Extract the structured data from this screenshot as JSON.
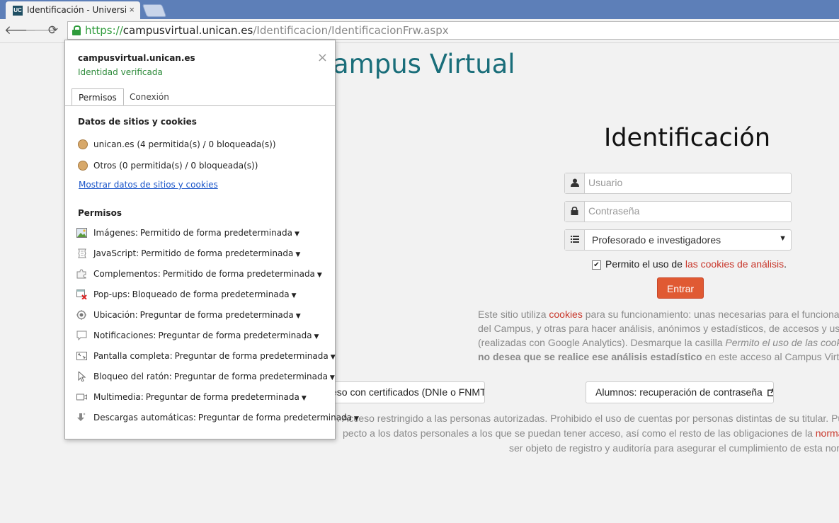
{
  "browser": {
    "tab_title": "Identificación - Universidad",
    "tab_close": "×",
    "favicon_text": "UC",
    "url_scheme": "https://",
    "url_host": "campusvirtual.unican.es",
    "url_path": "/Identificacion/IdentificacionFrw.aspx",
    "back": "🡐",
    "forward": "🡒",
    "reload": "⟳"
  },
  "popup": {
    "site": "campusvirtual.unican.es",
    "identity": "Identidad verificada",
    "close": "×",
    "tabs": [
      "Permisos",
      "Conexión"
    ],
    "cookies_heading": "Datos de sitios y cookies",
    "cookie_rows": [
      "unican.es (4 permitida(s) / 0 bloqueada(s))",
      "Otros (0 permitida(s) / 0 bloqueada(s))"
    ],
    "show_link": "Mostrar datos de sitios y cookies",
    "perms_heading": "Permisos",
    "permissions": [
      {
        "label": "Imágenes:",
        "value": "Permitido de forma predeterminada",
        "icon": "image-icon"
      },
      {
        "label": "JavaScript:",
        "value": "Permitido de forma predeterminada",
        "icon": "script-icon"
      },
      {
        "label": "Complementos:",
        "value": "Permitido de forma predeterminada",
        "icon": "puzzle-icon"
      },
      {
        "label": "Pop-ups:",
        "value": "Bloqueado de forma predeterminada",
        "icon": "popup-blocked-icon"
      },
      {
        "label": "Ubicación:",
        "value": "Preguntar de forma predeterminada",
        "icon": "location-icon"
      },
      {
        "label": "Notificaciones:",
        "value": "Preguntar de forma predeterminada",
        "icon": "speech-bubble-icon"
      },
      {
        "label": "Pantalla completa:",
        "value": "Preguntar de forma predeterminada",
        "icon": "fullscreen-icon"
      },
      {
        "label": "Bloqueo del ratón:",
        "value": "Preguntar de forma predeterminada",
        "icon": "cursor-icon"
      },
      {
        "label": "Multimedia:",
        "value": "Preguntar de forma predeterminada",
        "icon": "camera-icon"
      },
      {
        "label": "Descargas automáticas:",
        "value": "Preguntar de forma predeterminada",
        "icon": "download-icon"
      }
    ]
  },
  "page": {
    "brand": "ampus Virtual",
    "heading": "Identificación",
    "user_placeholder": "Usuario",
    "password_placeholder": "Contraseña",
    "role_selected": "Profesorado e investigadores",
    "consent_prefix": "Permito el uso de ",
    "consent_link": "las cookies de análisis",
    "consent_suffix": ".",
    "submit": "Entrar",
    "info_l1_a": "Este sitio utiliza ",
    "info_l1_link": "cookies",
    "info_l1_b": " para su funcionamiento: unas necesarias para el funcionamien",
    "info_l2": "del Campus, y otras para hacer análisis, anónimos y estadísticos, de accesos y uso de",
    "info_l3_a": "(realizadas con Google Analytics). Desmarque la casilla ",
    "info_l3_italic": "Permito el uso de las cookies de",
    "info_l4_bold": "no desea que se realice ese análisis estadístico",
    "info_l4_b": " en este acceso al Campus Virtual.",
    "cert_button": "eso con certificados (DNIe o FNMT)",
    "recover_button": "Alumnos: recuperación de contraseña",
    "foot_l1": ". Acceso restringido a las personas autorizadas. Prohibido el uso de cuentas por personas distintas de su titular. Pulsar \"Ent",
    "foot_l2_a": "pecto a los datos personales a los que se puedan tener acceso, así como el resto de las obligaciones de la ",
    "foot_l2_link": "normativa intern",
    "foot_l3": "ser objeto de registro y auditoría para asegurar el cumplimiento de esta normati"
  },
  "colors": {
    "brand": "#1a6e7a",
    "accent": "#e05a33",
    "link": "#c8362a",
    "secure": "#2e9b3b"
  }
}
